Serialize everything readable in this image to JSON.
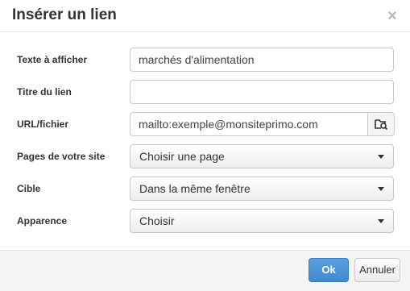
{
  "dialog": {
    "title": "Insérer un lien",
    "close_icon": "close-icon"
  },
  "form": {
    "text_to_display": {
      "label": "Texte à afficher",
      "value": "marchés d'alimentation"
    },
    "link_title": {
      "label": "Titre du lien",
      "value": ""
    },
    "url": {
      "label": "URL/fichier",
      "value": "mailto:exemple@monsiteprimo.com",
      "browse_icon": "folder-search-icon"
    },
    "site_pages": {
      "label": "Pages de votre site",
      "selected": "Choisir une page"
    },
    "target": {
      "label": "Cible",
      "selected": "Dans la même fenêtre"
    },
    "appearance": {
      "label": "Apparence",
      "selected": "Choisir"
    }
  },
  "footer": {
    "ok_label": "Ok",
    "cancel_label": "Annuler"
  },
  "colors": {
    "primary_button": "#4a90d9",
    "footer_background": "#f5f5f5"
  }
}
